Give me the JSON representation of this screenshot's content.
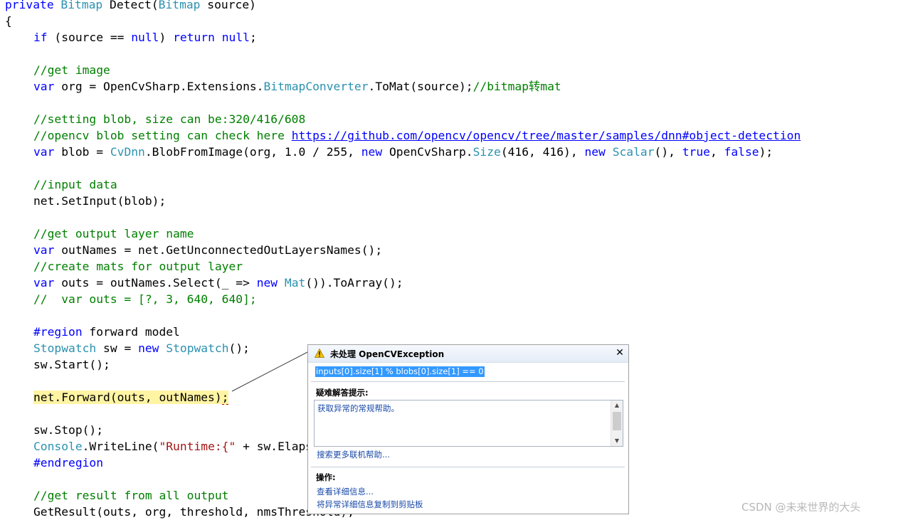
{
  "code": {
    "l01": {
      "a": "private ",
      "b": "Bitmap",
      "c": " Detect(",
      "d": "Bitmap",
      "e": " source)"
    },
    "l02": "{",
    "l03": {
      "a": "if",
      "b": " (source == ",
      "c": "null",
      "d": ") ",
      "e": "return",
      "f": " ",
      "g": "null",
      "h": ";"
    },
    "l05": "//get image",
    "l06": {
      "a": "var",
      "b": " org = OpenCvSharp.Extensions.",
      "c": "BitmapConverter",
      "d": ".ToMat(source);",
      "e": "//bitmap转mat"
    },
    "l08": "//setting blob, size can be:320/416/608",
    "l09": {
      "a": "//opencv blob setting can check here ",
      "b": "https://github.com/opencv/opencv/tree/master/samples/dnn#object-detection"
    },
    "l10": {
      "a": "var",
      "b": " blob = ",
      "c": "CvDnn",
      "d": ".BlobFromImage(org, 1.0 / 255, ",
      "e": "new",
      "f": " OpenCvSharp.",
      "g": "Size",
      "h": "(416, 416), ",
      "i": "new",
      "j": " ",
      "k": "Scalar",
      "l": "(), ",
      "m": "true",
      "n": ", ",
      "o": "false",
      "p": ");"
    },
    "l12": "//input data",
    "l13": "net.SetInput(blob);",
    "l15": "//get output layer name",
    "l16": {
      "a": "var",
      "b": " outNames = net.GetUnconnectedOutLayersNames();"
    },
    "l17": "//create mats for output layer",
    "l18": {
      "a": "var",
      "b": " outs = outNames.Select(_ => ",
      "c": "new",
      "d": " ",
      "e": "Mat",
      "f": "()).ToArray();"
    },
    "l19": "//  var outs = [?, 3, 640, 640];",
    "l21": {
      "a": "#region",
      "b": " forward model"
    },
    "l22": {
      "a": "Stopwatch",
      "b": " sw = ",
      "c": "new",
      "d": " ",
      "e": "Stopwatch",
      "f": "();"
    },
    "l23": "sw.Start();",
    "l25": {
      "a": "net.Forward(outs, outNames)",
      "b": ";"
    },
    "l27": "sw.Stop();",
    "l28": {
      "a": "Console",
      "b": ".WriteLine(",
      "c": "\"Runtime:{\"",
      "d": " + sw.Elapsed"
    },
    "l29": "#endregion",
    "l31": "//get result from all output",
    "l32": "GetResult(outs, org, threshold, nmsThreshold);"
  },
  "dialog": {
    "icon": "warning-icon",
    "title": "未处理 OpenCVException",
    "close_symbol": "✕",
    "error_message": "inputs[0].size[1] % blobs[0].size[1] == 0",
    "tips_heading": "疑难解答提示:",
    "tips_link": "获取异常的常规帮助。",
    "scroll_up_symbol": "▲",
    "scroll_down_symbol": "▼",
    "search_link": "搜索更多联机帮助...",
    "actions_heading": "操作:",
    "action_view_details": "查看详细信息...",
    "action_copy": "将异常详细信息复制到剪贴板"
  },
  "watermark": "CSDN @未来世界的大头"
}
